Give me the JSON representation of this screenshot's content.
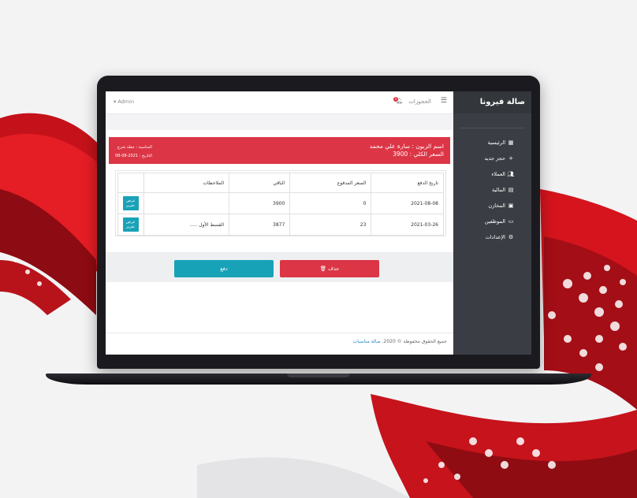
{
  "app": {
    "brand": "صالة فيرونا",
    "user_label": "Admin",
    "reservations_label": "الحجوزات",
    "notification_count": "1"
  },
  "sidebar": {
    "items": [
      {
        "label": "الرئيسية",
        "icon": "grid-icon"
      },
      {
        "label": "حجز جديد",
        "icon": "plus-icon"
      },
      {
        "label": "العملاء",
        "icon": "users-icon"
      },
      {
        "label": "المالية",
        "icon": "file-icon"
      },
      {
        "label": "المخازن",
        "icon": "warehouse-icon"
      },
      {
        "label": "الموظفين",
        "icon": "id-card-icon"
      },
      {
        "label": "الإعدادات",
        "icon": "cogs-icon"
      }
    ]
  },
  "alert": {
    "customer": "اسم الزبون : سارة علي محمد",
    "total": "السعر الكلي : 3900",
    "occasion": "المناسبة : حفلة تخرج",
    "date": "التاريخ : 2021-08-08"
  },
  "table": {
    "headers": [
      "تاريخ الدفع",
      "السعر المدفوع",
      "الباقي",
      "الملاحظات",
      ""
    ],
    "rows": [
      {
        "date": "2021-08-08",
        "paid": "0",
        "remaining": "3900",
        "notes": "",
        "action": "عرض تقرير"
      },
      {
        "date": "2021-03-26",
        "paid": "23",
        "remaining": "3877",
        "notes": "القسط الأول .....",
        "action": "عرض تقرير"
      }
    ]
  },
  "actions": {
    "delete_label": "حذف",
    "pay_label": "دفع"
  },
  "footer": {
    "text": "جميع الحقوق محفوظة © 2020.",
    "link": "صالة مناسبات"
  },
  "colors": {
    "accent_red": "#dc3545",
    "accent_teal": "#17a2b8",
    "sidebar": "#3a3e44"
  }
}
